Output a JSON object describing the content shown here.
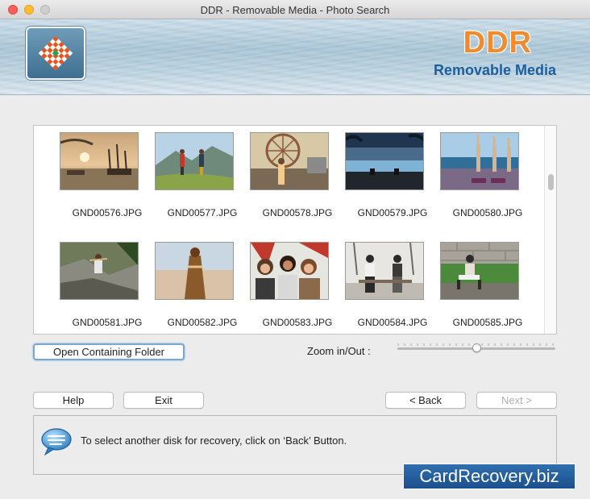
{
  "window": {
    "title": "DDR - Removable Media - Photo Search"
  },
  "banner": {
    "brand": "DDR",
    "subtitle": "Removable Media"
  },
  "gallery": {
    "items": [
      {
        "file": "GND00576.JPG",
        "scene": "boats-sunset"
      },
      {
        "file": "GND00577.JPG",
        "scene": "hikers-mountain"
      },
      {
        "file": "GND00578.JPG",
        "scene": "fair-ferris-wheel"
      },
      {
        "file": "GND00579.JPG",
        "scene": "pool-lake"
      },
      {
        "file": "GND00580.JPG",
        "scene": "yoga-beach"
      },
      {
        "file": "GND00581.JPG",
        "scene": "rock-climber"
      },
      {
        "file": "GND00582.JPG",
        "scene": "woman-beach"
      },
      {
        "file": "GND00583.JPG",
        "scene": "group-selfie"
      },
      {
        "file": "GND00584.JPG",
        "scene": "couple-bench"
      },
      {
        "file": "GND00585.JPG",
        "scene": "garden-wall"
      }
    ]
  },
  "actions": {
    "open_folder": "Open Containing Folder",
    "zoom_label": "Zoom in/Out :",
    "zoom_level": 0.5,
    "help": "Help",
    "exit": "Exit",
    "back": "< Back",
    "next": "Next >"
  },
  "info": {
    "message": "To select another disk for recovery, click on ‘Back’ Button."
  },
  "watermark": "CardRecovery.biz",
  "colors": {
    "accent": "#1b5f9e",
    "brand_orange": "#f28a2e",
    "focus": "#7aa7d6"
  }
}
